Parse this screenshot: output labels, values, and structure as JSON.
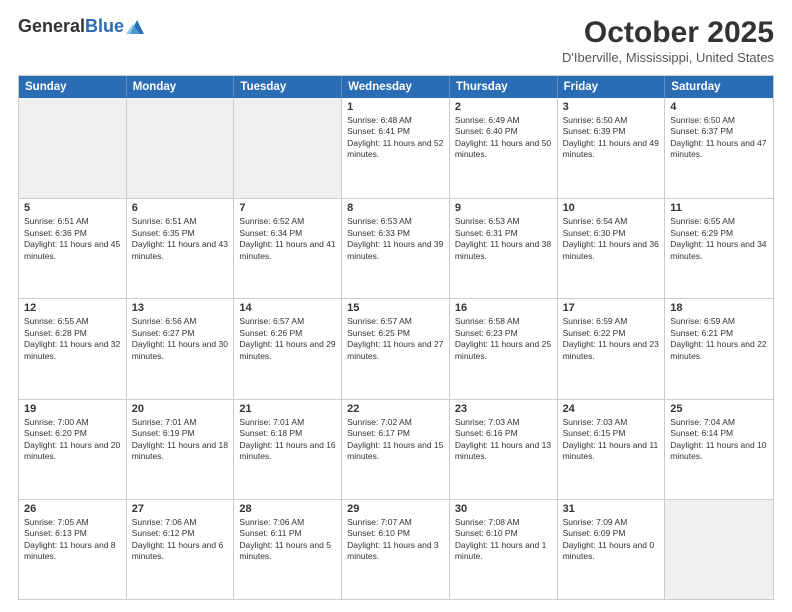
{
  "logo": {
    "general": "General",
    "blue": "Blue"
  },
  "header": {
    "month": "October 2025",
    "location": "D'Iberville, Mississippi, United States"
  },
  "weekdays": [
    "Sunday",
    "Monday",
    "Tuesday",
    "Wednesday",
    "Thursday",
    "Friday",
    "Saturday"
  ],
  "weeks": [
    [
      {
        "day": "",
        "sunrise": "",
        "sunset": "",
        "daylight": ""
      },
      {
        "day": "",
        "sunrise": "",
        "sunset": "",
        "daylight": ""
      },
      {
        "day": "",
        "sunrise": "",
        "sunset": "",
        "daylight": ""
      },
      {
        "day": "1",
        "sunrise": "Sunrise: 6:48 AM",
        "sunset": "Sunset: 6:41 PM",
        "daylight": "Daylight: 11 hours and 52 minutes."
      },
      {
        "day": "2",
        "sunrise": "Sunrise: 6:49 AM",
        "sunset": "Sunset: 6:40 PM",
        "daylight": "Daylight: 11 hours and 50 minutes."
      },
      {
        "day": "3",
        "sunrise": "Sunrise: 6:50 AM",
        "sunset": "Sunset: 6:39 PM",
        "daylight": "Daylight: 11 hours and 49 minutes."
      },
      {
        "day": "4",
        "sunrise": "Sunrise: 6:50 AM",
        "sunset": "Sunset: 6:37 PM",
        "daylight": "Daylight: 11 hours and 47 minutes."
      }
    ],
    [
      {
        "day": "5",
        "sunrise": "Sunrise: 6:51 AM",
        "sunset": "Sunset: 6:36 PM",
        "daylight": "Daylight: 11 hours and 45 minutes."
      },
      {
        "day": "6",
        "sunrise": "Sunrise: 6:51 AM",
        "sunset": "Sunset: 6:35 PM",
        "daylight": "Daylight: 11 hours and 43 minutes."
      },
      {
        "day": "7",
        "sunrise": "Sunrise: 6:52 AM",
        "sunset": "Sunset: 6:34 PM",
        "daylight": "Daylight: 11 hours and 41 minutes."
      },
      {
        "day": "8",
        "sunrise": "Sunrise: 6:53 AM",
        "sunset": "Sunset: 6:33 PM",
        "daylight": "Daylight: 11 hours and 39 minutes."
      },
      {
        "day": "9",
        "sunrise": "Sunrise: 6:53 AM",
        "sunset": "Sunset: 6:31 PM",
        "daylight": "Daylight: 11 hours and 38 minutes."
      },
      {
        "day": "10",
        "sunrise": "Sunrise: 6:54 AM",
        "sunset": "Sunset: 6:30 PM",
        "daylight": "Daylight: 11 hours and 36 minutes."
      },
      {
        "day": "11",
        "sunrise": "Sunrise: 6:55 AM",
        "sunset": "Sunset: 6:29 PM",
        "daylight": "Daylight: 11 hours and 34 minutes."
      }
    ],
    [
      {
        "day": "12",
        "sunrise": "Sunrise: 6:55 AM",
        "sunset": "Sunset: 6:28 PM",
        "daylight": "Daylight: 11 hours and 32 minutes."
      },
      {
        "day": "13",
        "sunrise": "Sunrise: 6:56 AM",
        "sunset": "Sunset: 6:27 PM",
        "daylight": "Daylight: 11 hours and 30 minutes."
      },
      {
        "day": "14",
        "sunrise": "Sunrise: 6:57 AM",
        "sunset": "Sunset: 6:26 PM",
        "daylight": "Daylight: 11 hours and 29 minutes."
      },
      {
        "day": "15",
        "sunrise": "Sunrise: 6:57 AM",
        "sunset": "Sunset: 6:25 PM",
        "daylight": "Daylight: 11 hours and 27 minutes."
      },
      {
        "day": "16",
        "sunrise": "Sunrise: 6:58 AM",
        "sunset": "Sunset: 6:23 PM",
        "daylight": "Daylight: 11 hours and 25 minutes."
      },
      {
        "day": "17",
        "sunrise": "Sunrise: 6:59 AM",
        "sunset": "Sunset: 6:22 PM",
        "daylight": "Daylight: 11 hours and 23 minutes."
      },
      {
        "day": "18",
        "sunrise": "Sunrise: 6:59 AM",
        "sunset": "Sunset: 6:21 PM",
        "daylight": "Daylight: 11 hours and 22 minutes."
      }
    ],
    [
      {
        "day": "19",
        "sunrise": "Sunrise: 7:00 AM",
        "sunset": "Sunset: 6:20 PM",
        "daylight": "Daylight: 11 hours and 20 minutes."
      },
      {
        "day": "20",
        "sunrise": "Sunrise: 7:01 AM",
        "sunset": "Sunset: 6:19 PM",
        "daylight": "Daylight: 11 hours and 18 minutes."
      },
      {
        "day": "21",
        "sunrise": "Sunrise: 7:01 AM",
        "sunset": "Sunset: 6:18 PM",
        "daylight": "Daylight: 11 hours and 16 minutes."
      },
      {
        "day": "22",
        "sunrise": "Sunrise: 7:02 AM",
        "sunset": "Sunset: 6:17 PM",
        "daylight": "Daylight: 11 hours and 15 minutes."
      },
      {
        "day": "23",
        "sunrise": "Sunrise: 7:03 AM",
        "sunset": "Sunset: 6:16 PM",
        "daylight": "Daylight: 11 hours and 13 minutes."
      },
      {
        "day": "24",
        "sunrise": "Sunrise: 7:03 AM",
        "sunset": "Sunset: 6:15 PM",
        "daylight": "Daylight: 11 hours and 11 minutes."
      },
      {
        "day": "25",
        "sunrise": "Sunrise: 7:04 AM",
        "sunset": "Sunset: 6:14 PM",
        "daylight": "Daylight: 11 hours and 10 minutes."
      }
    ],
    [
      {
        "day": "26",
        "sunrise": "Sunrise: 7:05 AM",
        "sunset": "Sunset: 6:13 PM",
        "daylight": "Daylight: 11 hours and 8 minutes."
      },
      {
        "day": "27",
        "sunrise": "Sunrise: 7:06 AM",
        "sunset": "Sunset: 6:12 PM",
        "daylight": "Daylight: 11 hours and 6 minutes."
      },
      {
        "day": "28",
        "sunrise": "Sunrise: 7:06 AM",
        "sunset": "Sunset: 6:11 PM",
        "daylight": "Daylight: 11 hours and 5 minutes."
      },
      {
        "day": "29",
        "sunrise": "Sunrise: 7:07 AM",
        "sunset": "Sunset: 6:10 PM",
        "daylight": "Daylight: 11 hours and 3 minutes."
      },
      {
        "day": "30",
        "sunrise": "Sunrise: 7:08 AM",
        "sunset": "Sunset: 6:10 PM",
        "daylight": "Daylight: 11 hours and 1 minute."
      },
      {
        "day": "31",
        "sunrise": "Sunrise: 7:09 AM",
        "sunset": "Sunset: 6:09 PM",
        "daylight": "Daylight: 11 hours and 0 minutes."
      },
      {
        "day": "",
        "sunrise": "",
        "sunset": "",
        "daylight": ""
      }
    ]
  ]
}
